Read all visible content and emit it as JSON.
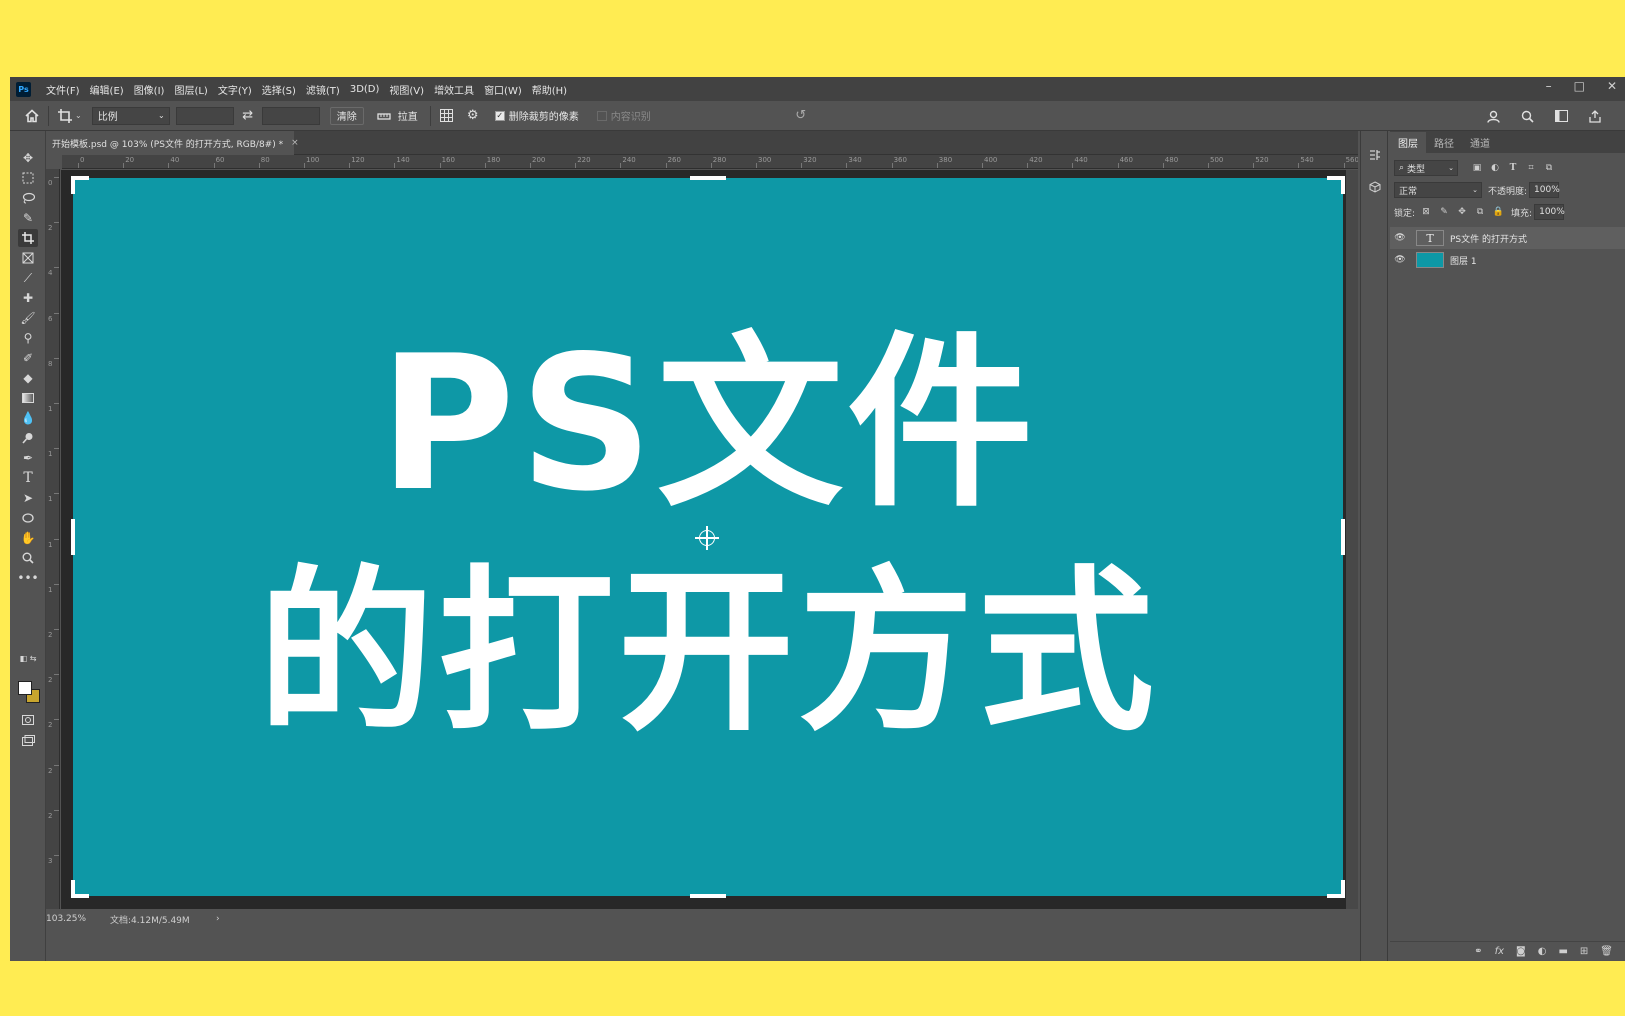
{
  "app": {
    "logo": "Ps",
    "menu": [
      "文件(F)",
      "编辑(E)",
      "图像(I)",
      "图层(L)",
      "文字(Y)",
      "选择(S)",
      "滤镜(T)",
      "3D(D)",
      "视图(V)",
      "增效工具",
      "窗口(W)",
      "帮助(H)"
    ],
    "window_controls": [
      "–",
      "□",
      "✕"
    ]
  },
  "options_bar": {
    "ratio_select": "比例",
    "swap_icon": "⇄",
    "clear_button": "清除",
    "straighten_label": "拉直",
    "delete_cropped_checked": true,
    "delete_cropped_label": "删除裁剪的像素",
    "content_aware_checked": false,
    "content_aware_label": "内容识别",
    "reset_icon": "↺"
  },
  "document": {
    "tab_title": "开始模板.psd @ 103% (PS文件 的打开方式, RGB/8#) *",
    "close": "×",
    "canvas_color": "#0e98a6",
    "line1": "PS文件",
    "line2": "的打开方式"
  },
  "rulers": {
    "horizontal": [
      "0",
      "20",
      "40",
      "60",
      "80",
      "100",
      "120",
      "140",
      "160",
      "180",
      "200",
      "220",
      "240",
      "260",
      "280",
      "300",
      "320",
      "340",
      "360",
      "380",
      "400",
      "420",
      "440",
      "460",
      "480",
      "500",
      "520",
      "540",
      "560"
    ],
    "vertical": [
      "0",
      "2",
      "4",
      "6",
      "8",
      "1",
      "1",
      "1",
      "1",
      "1",
      "2",
      "2",
      "2",
      "2",
      "2",
      "3"
    ]
  },
  "status": {
    "zoom": "103.25%",
    "doc_size": "文档:4.12M/5.49M",
    "arrow": "›"
  },
  "layers_panel": {
    "tabs": [
      "图层",
      "路径",
      "通道"
    ],
    "filter_kind": "类型",
    "blend_mode": "正常",
    "opacity_label": "不透明度:",
    "opacity_value": "100%",
    "lock_label": "锁定:",
    "fill_label": "填充:",
    "fill_value": "100%",
    "layers": [
      {
        "name": "PS文件 的打开方式",
        "type": "text",
        "visible": true,
        "selected": true
      },
      {
        "name": "图层 1",
        "type": "pixel",
        "visible": true,
        "selected": false,
        "color": "#0e98a6"
      }
    ]
  }
}
